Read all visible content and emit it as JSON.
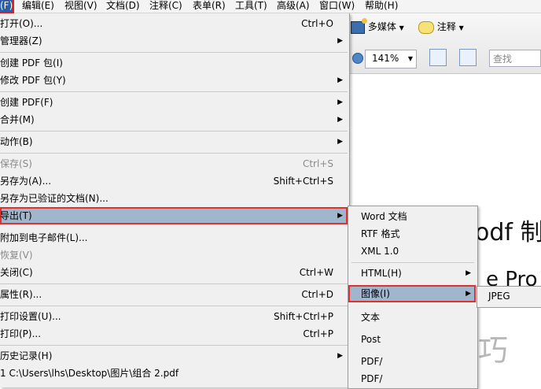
{
  "menubar": {
    "items": [
      "(F)",
      "编辑(E)",
      "视图(V)",
      "文档(D)",
      "注释(C)",
      "表单(R)",
      "工具(T)",
      "高级(A)",
      "窗口(W)",
      "帮助(H)"
    ]
  },
  "toolbar": {
    "multimedia_label": "多媒体",
    "comment_label": "注释",
    "zoom_value": "141%",
    "search_placeholder": "查找"
  },
  "document": {
    "line1": "odf 制",
    "line2": "e Pro 转",
    "watermark": "软件技巧"
  },
  "file_menu": {
    "items": [
      {
        "label": "打开(O)...",
        "shortcut": "Ctrl+O"
      },
      {
        "label": "管理器(Z)"
      },
      {
        "label": "创建 PDF 包(I)"
      },
      {
        "label": "修改 PDF 包(Y)"
      },
      {
        "label": "创建 PDF(F)"
      },
      {
        "label": "合并(M)"
      },
      {
        "label": "动作(B)"
      },
      {
        "label": "保存(S)",
        "shortcut": "Ctrl+S"
      },
      {
        "label": "另存为(A)...",
        "shortcut": "Shift+Ctrl+S"
      },
      {
        "label": "另存为已验证的文档(N)..."
      },
      {
        "label": "导出(T)"
      },
      {
        "label": "附加到电子邮件(L)..."
      },
      {
        "label": "恢复(V)"
      },
      {
        "label": "关闭(C)",
        "shortcut": "Ctrl+W"
      },
      {
        "label": "属性(R)...",
        "shortcut": "Ctrl+D"
      },
      {
        "label": "打印设置(U)...",
        "shortcut": "Shift+Ctrl+P"
      },
      {
        "label": "打印(P)...",
        "shortcut": "Ctrl+P"
      },
      {
        "label": "历史记录(H)"
      },
      {
        "label": "1 C:\\Users\\lhs\\Desktop\\图片\\组合 2.pdf"
      }
    ]
  },
  "export_menu": {
    "items": [
      "Word 文档",
      "RTF 格式",
      "XML 1.0",
      "HTML(H)",
      "图像(I)",
      "文本",
      "Post",
      "PDF/",
      "PDF/"
    ]
  },
  "image_menu": {
    "items": [
      "JPEG"
    ]
  }
}
